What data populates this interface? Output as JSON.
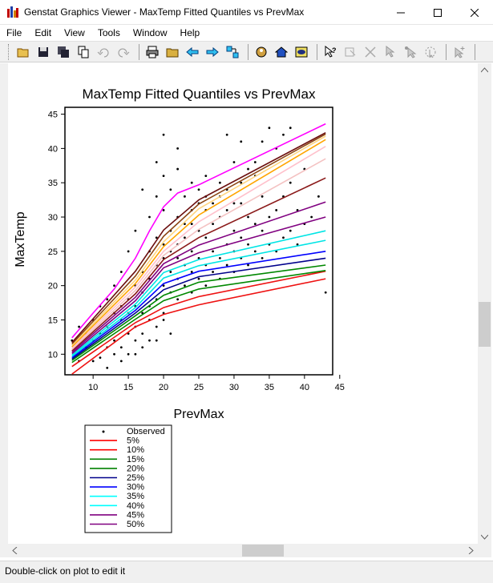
{
  "window": {
    "title": "Genstat Graphics Viewer - MaxTemp Fitted Quantiles vs PrevMax",
    "icon": "genstat-app-icon",
    "controls": [
      "minimize-icon",
      "maximize-icon",
      "close-icon"
    ]
  },
  "menu": {
    "items": [
      "File",
      "Edit",
      "View",
      "Tools",
      "Window",
      "Help"
    ]
  },
  "toolbar": {
    "buttons": [
      "open-icon",
      "save-icon",
      "save-all-icon",
      "copy-icon",
      "undo-icon",
      "redo-icon",
      "print-icon",
      "folder-icon",
      "back-icon",
      "forward-icon",
      "arrange-icon",
      "zoom-icon",
      "home-icon",
      "view-icon",
      "help-pointer-icon",
      "identify-icon",
      "delete-point-icon",
      "select-icon",
      "select-point-icon",
      "select-region-icon",
      "add-point-icon"
    ]
  },
  "statusbar": {
    "text": "Double-click on plot to edit it"
  },
  "chart_data": {
    "type": "scatter",
    "title": "MaxTemp Fitted Quantiles vs PrevMax",
    "xlabel": "PrevMax",
    "ylabel": "MaxTemp",
    "xlim": [
      6,
      44
    ],
    "ylim": [
      7,
      46
    ],
    "xticks": [
      10,
      15,
      20,
      25,
      30,
      35,
      40,
      45
    ],
    "yticks": [
      10,
      15,
      20,
      25,
      30,
      35,
      40,
      45
    ],
    "legend_position": "bottom-left, below plot",
    "legend": [
      {
        "label": "Observed",
        "color": "#000000",
        "kind": "point"
      },
      {
        "label": "5%",
        "color": "#ff0000",
        "kind": "line"
      },
      {
        "label": "10%",
        "color": "#ff0000",
        "kind": "line"
      },
      {
        "label": "15%",
        "color": "#008000",
        "kind": "line"
      },
      {
        "label": "20%",
        "color": "#008000",
        "kind": "line"
      },
      {
        "label": "25%",
        "color": "#00008b",
        "kind": "line"
      },
      {
        "label": "30%",
        "color": "#0000ff",
        "kind": "line"
      },
      {
        "label": "35%",
        "color": "#00ffff",
        "kind": "line"
      },
      {
        "label": "40%",
        "color": "#00ffff",
        "kind": "line"
      },
      {
        "label": "45%",
        "color": "#800080",
        "kind": "line"
      },
      {
        "label": "50%",
        "color": "#800080",
        "kind": "line"
      }
    ],
    "series": [
      {
        "name": "5%",
        "color": "#ee1111",
        "x": [
          7,
          16,
          20,
          25,
          43
        ],
        "y": [
          7.1,
          14.0,
          15.8,
          17.2,
          21.0
        ]
      },
      {
        "name": "10%",
        "color": "#ee1111",
        "x": [
          7,
          16,
          20,
          25,
          43
        ],
        "y": [
          8.2,
          14.6,
          16.8,
          18.4,
          22.1
        ]
      },
      {
        "name": "15%",
        "color": "#008800",
        "x": [
          7,
          16,
          20,
          25,
          43
        ],
        "y": [
          8.8,
          15.1,
          17.8,
          19.5,
          22.2
        ]
      },
      {
        "name": "20%",
        "color": "#008800",
        "x": [
          7,
          16,
          20,
          25,
          43
        ],
        "y": [
          9.1,
          15.6,
          18.6,
          20.5,
          23.0
        ]
      },
      {
        "name": "25%",
        "color": "#00008b",
        "x": [
          7,
          16,
          20,
          25,
          43
        ],
        "y": [
          9.3,
          16.0,
          19.4,
          21.3,
          24.0
        ]
      },
      {
        "name": "30%",
        "color": "#0000ff",
        "x": [
          7,
          16,
          20,
          25,
          43
        ],
        "y": [
          9.5,
          16.4,
          20.3,
          22.1,
          25.0
        ]
      },
      {
        "name": "35%",
        "color": "#00e5e5",
        "x": [
          7,
          16,
          20,
          25,
          43
        ],
        "y": [
          9.7,
          16.8,
          21.1,
          22.9,
          26.6
        ]
      },
      {
        "name": "40%",
        "color": "#00e5e5",
        "x": [
          7,
          16,
          20,
          25,
          43
        ],
        "y": [
          9.9,
          17.3,
          21.9,
          23.8,
          28.0
        ]
      },
      {
        "name": "45%",
        "color": "#800080",
        "x": [
          7,
          16,
          20,
          25,
          43
        ],
        "y": [
          10.1,
          17.8,
          22.6,
          24.8,
          30.0
        ]
      },
      {
        "name": "50%",
        "color": "#800080",
        "x": [
          7,
          16,
          20,
          25,
          43
        ],
        "y": [
          10.3,
          18.3,
          23.2,
          25.9,
          32.2
        ]
      },
      {
        "name": "",
        "color": "#8b1a1a",
        "x": [
          7,
          16,
          20,
          25,
          43
        ],
        "y": [
          10.5,
          18.8,
          23.8,
          27.0,
          35.7
        ]
      },
      {
        "name": "",
        "color": "#f4c2c2",
        "x": [
          7,
          16,
          20,
          25,
          43
        ],
        "y": [
          10.7,
          19.3,
          24.4,
          28.2,
          38.5
        ]
      },
      {
        "name": "",
        "color": "#ffc0cb",
        "x": [
          7,
          16,
          20,
          25,
          43
        ],
        "y": [
          10.9,
          19.8,
          25.0,
          29.3,
          40.3
        ]
      },
      {
        "name": "",
        "color": "#ffa500",
        "x": [
          7,
          16,
          20,
          25,
          43
        ],
        "y": [
          11.1,
          20.3,
          25.7,
          30.3,
          41.3
        ]
      },
      {
        "name": "",
        "color": "#ffd580",
        "x": [
          7,
          16,
          20,
          25,
          43
        ],
        "y": [
          11.3,
          20.8,
          26.4,
          31.2,
          41.8
        ]
      },
      {
        "name": "",
        "color": "#8b4513",
        "x": [
          7,
          16,
          20,
          25,
          43
        ],
        "y": [
          11.5,
          21.4,
          27.2,
          31.9,
          42.1
        ]
      },
      {
        "name": "",
        "color": "#6b0f0f",
        "x": [
          7,
          16,
          20,
          25,
          43
        ],
        "y": [
          11.7,
          22.1,
          28.1,
          32.5,
          42.3
        ]
      },
      {
        "name": "",
        "color": "#ff00ff",
        "x": [
          7,
          10,
          13,
          16,
          18,
          20,
          22,
          25,
          43
        ],
        "y": [
          12.4,
          16.0,
          19.5,
          24.0,
          28.0,
          31.5,
          33.5,
          34.7,
          43.6
        ]
      }
    ],
    "observed": [
      [
        9,
        11
      ],
      [
        10,
        12
      ],
      [
        11,
        9.5
      ],
      [
        12,
        8
      ],
      [
        12,
        14
      ],
      [
        13,
        10
      ],
      [
        13,
        12
      ],
      [
        14,
        11
      ],
      [
        14,
        15
      ],
      [
        15,
        13
      ],
      [
        15,
        10
      ],
      [
        15,
        18
      ],
      [
        16,
        14
      ],
      [
        16,
        12
      ],
      [
        16,
        20
      ],
      [
        17,
        16
      ],
      [
        17,
        13
      ],
      [
        17,
        22
      ],
      [
        18,
        17
      ],
      [
        18,
        15
      ],
      [
        18,
        25
      ],
      [
        18,
        30
      ],
      [
        19,
        18
      ],
      [
        19,
        14
      ],
      [
        19,
        27
      ],
      [
        19,
        33
      ],
      [
        20,
        20
      ],
      [
        20,
        16
      ],
      [
        20,
        24
      ],
      [
        20,
        31
      ],
      [
        20,
        36
      ],
      [
        21,
        19
      ],
      [
        21,
        22
      ],
      [
        21,
        28
      ],
      [
        21,
        34
      ],
      [
        22,
        18
      ],
      [
        22,
        21
      ],
      [
        22,
        26
      ],
      [
        22,
        30
      ],
      [
        22,
        37
      ],
      [
        23,
        20
      ],
      [
        23,
        23
      ],
      [
        23,
        27
      ],
      [
        23,
        33
      ],
      [
        24,
        19
      ],
      [
        24,
        22
      ],
      [
        24,
        25
      ],
      [
        24,
        29
      ],
      [
        24,
        35
      ],
      [
        25,
        21
      ],
      [
        25,
        24
      ],
      [
        25,
        28
      ],
      [
        25,
        32
      ],
      [
        26,
        20
      ],
      [
        26,
        23
      ],
      [
        26,
        27
      ],
      [
        26,
        31
      ],
      [
        26,
        36
      ],
      [
        27,
        22
      ],
      [
        27,
        25
      ],
      [
        27,
        29
      ],
      [
        28,
        21
      ],
      [
        28,
        24
      ],
      [
        28,
        30
      ],
      [
        28,
        35
      ],
      [
        29,
        23
      ],
      [
        29,
        26
      ],
      [
        29,
        31
      ],
      [
        30,
        22
      ],
      [
        30,
        25
      ],
      [
        30,
        28
      ],
      [
        30,
        38
      ],
      [
        31,
        24
      ],
      [
        31,
        27
      ],
      [
        31,
        32
      ],
      [
        32,
        23
      ],
      [
        32,
        26
      ],
      [
        32,
        30
      ],
      [
        33,
        25
      ],
      [
        33,
        29
      ],
      [
        33,
        36
      ],
      [
        34,
        24
      ],
      [
        34,
        28
      ],
      [
        34,
        33
      ],
      [
        35,
        26
      ],
      [
        35,
        30
      ],
      [
        36,
        25
      ],
      [
        36,
        31
      ],
      [
        36,
        40
      ],
      [
        37,
        27
      ],
      [
        37,
        33
      ],
      [
        38,
        28
      ],
      [
        38,
        35
      ],
      [
        39,
        26
      ],
      [
        39,
        31
      ],
      [
        40,
        29
      ],
      [
        40,
        37
      ],
      [
        41,
        30
      ],
      [
        42,
        33
      ],
      [
        43,
        19
      ],
      [
        11,
        13
      ],
      [
        13,
        16
      ],
      [
        14,
        17
      ],
      [
        15,
        16
      ],
      [
        16,
        17
      ],
      [
        17,
        19
      ],
      [
        18,
        21
      ],
      [
        19,
        23
      ],
      [
        20,
        26
      ],
      [
        21,
        25
      ],
      [
        22,
        24
      ],
      [
        23,
        29
      ],
      [
        24,
        31
      ],
      [
        25,
        34
      ],
      [
        26,
        33
      ],
      [
        27,
        32
      ],
      [
        28,
        33
      ],
      [
        29,
        34
      ],
      [
        30,
        32
      ],
      [
        31,
        35
      ],
      [
        32,
        37
      ],
      [
        33,
        38
      ],
      [
        34,
        41
      ],
      [
        35,
        43
      ],
      [
        37,
        42
      ],
      [
        38,
        43
      ],
      [
        29,
        42
      ],
      [
        31,
        41
      ],
      [
        20,
        42
      ],
      [
        22,
        40
      ],
      [
        17,
        34
      ],
      [
        19,
        38
      ],
      [
        16,
        28
      ],
      [
        15,
        25
      ],
      [
        14,
        22
      ],
      [
        13,
        20
      ],
      [
        12,
        18
      ],
      [
        11,
        17
      ],
      [
        10,
        15
      ],
      [
        9,
        13
      ],
      [
        8,
        14
      ],
      [
        7,
        12
      ],
      [
        8,
        9
      ],
      [
        10,
        9
      ],
      [
        12,
        11
      ],
      [
        14,
        9
      ],
      [
        16,
        10
      ],
      [
        17,
        11
      ],
      [
        19,
        12
      ],
      [
        21,
        13
      ],
      [
        20,
        15
      ],
      [
        18,
        12
      ]
    ]
  }
}
